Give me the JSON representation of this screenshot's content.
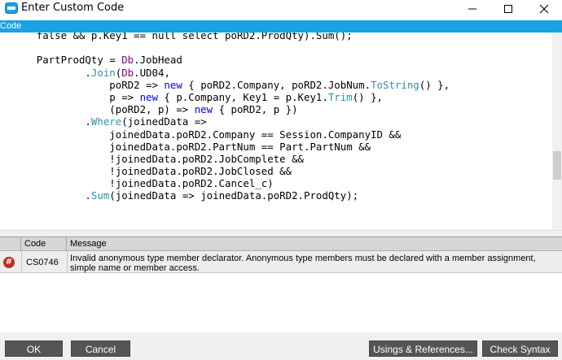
{
  "window": {
    "title": "Enter Custom Code",
    "icon": "app-dialog-icon",
    "minimize": "─",
    "maximize": "☐",
    "close": "✕"
  },
  "code_panel": {
    "header": "Code",
    "lines": [
      [
        {
          "t": "      "
        },
        {
          "t": "false && p.Key1 == null select poRD2.ProdQty).Sum();"
        }
      ],
      [
        {
          "t": ""
        }
      ],
      [
        {
          "t": "      PartProdQty = "
        },
        {
          "t": "Db",
          "c": "prop"
        },
        {
          "t": ".JobHead"
        }
      ],
      [
        {
          "t": "              ."
        },
        {
          "t": "Join",
          "c": "mth"
        },
        {
          "t": "("
        },
        {
          "t": "Db",
          "c": "prop"
        },
        {
          "t": ".UD04,"
        }
      ],
      [
        {
          "t": "                  poRD2 => "
        },
        {
          "t": "new",
          "c": "kw"
        },
        {
          "t": " { poRD2.Company, poRD2.JobNum."
        },
        {
          "t": "ToString",
          "c": "mth"
        },
        {
          "t": "() },"
        }
      ],
      [
        {
          "t": "                  p => "
        },
        {
          "t": "new",
          "c": "kw"
        },
        {
          "t": " { p.Company, Key1 = p.Key1."
        },
        {
          "t": "Trim",
          "c": "mth"
        },
        {
          "t": "() },"
        }
      ],
      [
        {
          "t": "                  (poRD2, p) => "
        },
        {
          "t": "new",
          "c": "kw"
        },
        {
          "t": " { poRD2, p })"
        }
      ],
      [
        {
          "t": "              ."
        },
        {
          "t": "Where",
          "c": "mth"
        },
        {
          "t": "(joinedData =>"
        }
      ],
      [
        {
          "t": "                  joinedData.poRD2.Company == Session.CompanyID &&"
        }
      ],
      [
        {
          "t": "                  joinedData.poRD2.PartNum == Part.PartNum &&"
        }
      ],
      [
        {
          "t": "                  !joinedData.poRD2.JobComplete &&"
        }
      ],
      [
        {
          "t": "                  !joinedData.poRD2.JobClosed &&"
        }
      ],
      [
        {
          "t": "                  !joinedData.poRD2.Cancel_c)"
        }
      ],
      [
        {
          "t": "              ."
        },
        {
          "t": "Sum",
          "c": "mth"
        },
        {
          "t": "(joinedData => joinedData.poRD2.ProdQty);"
        }
      ]
    ]
  },
  "error_list": {
    "columns": [
      "",
      "Code",
      "Message"
    ],
    "rows": [
      {
        "icon": "error-hash-icon",
        "icon_glyph": "#",
        "code": "CS0746",
        "message": "Invalid anonymous type member declarator. Anonymous type members must be declared with a member assignment, simple name or member access."
      }
    ]
  },
  "buttons": {
    "ok": "OK",
    "cancel": "Cancel",
    "usings": "Usings & References...",
    "check_syntax": "Check Syntax"
  },
  "colors": {
    "header_blue": "#1ba1e2",
    "button_gray": "#555555",
    "keyword": "#0000ff",
    "method": "#2b91af",
    "db": "#8b008b",
    "error_red": "#c62828"
  }
}
